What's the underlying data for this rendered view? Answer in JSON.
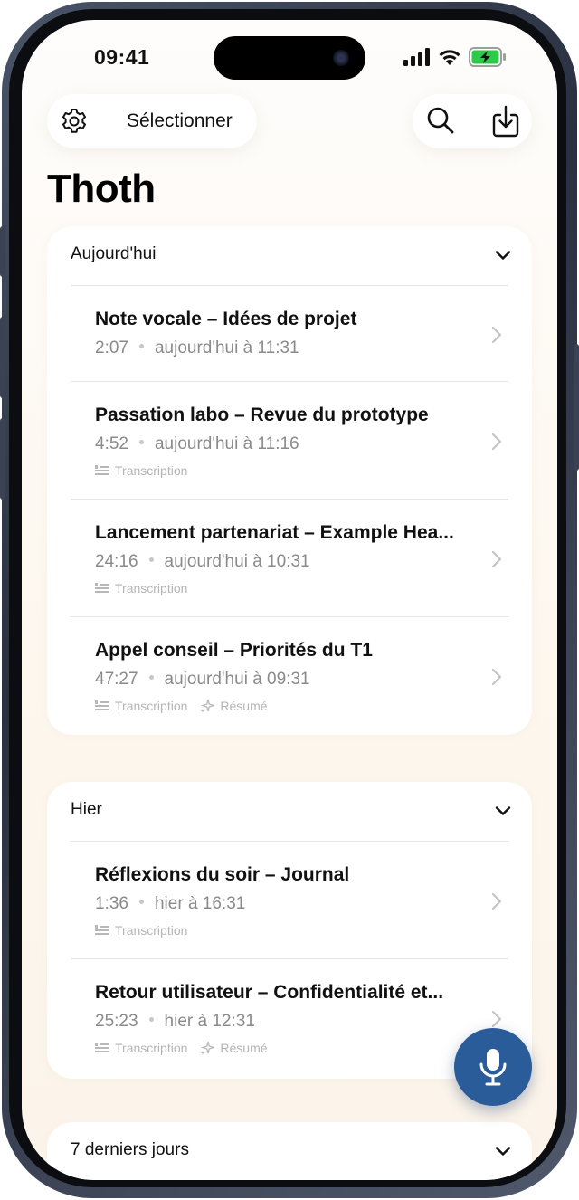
{
  "status_bar": {
    "time": "09:41"
  },
  "toolbar": {
    "select_label": "Sélectionner",
    "settings_icon": "gear-icon",
    "search_icon": "search-icon",
    "download_icon": "download-icon"
  },
  "page": {
    "title": "Thoth"
  },
  "sections": [
    {
      "label": "Aujourd'hui",
      "items": [
        {
          "title": "Note vocale – Idées de projet",
          "duration": "2:07",
          "when": "aujourd'hui à 11:31",
          "tags": []
        },
        {
          "title": "Passation labo – Revue du prototype",
          "duration": "4:52",
          "when": "aujourd'hui à 11:16",
          "tags": [
            "Transcription"
          ]
        },
        {
          "title": "Lancement partenariat – Example Hea...",
          "duration": "24:16",
          "when": "aujourd'hui à 10:31",
          "tags": [
            "Transcription"
          ]
        },
        {
          "title": "Appel conseil – Priorités du T1",
          "duration": "47:27",
          "when": "aujourd'hui à 09:31",
          "tags": [
            "Transcription",
            "Résumé"
          ]
        }
      ]
    },
    {
      "label": "Hier",
      "items": [
        {
          "title": "Réflexions du soir – Journal",
          "duration": "1:36",
          "when": "hier à 16:31",
          "tags": [
            "Transcription"
          ]
        },
        {
          "title": "Retour utilisateur – Confidentialité et...",
          "duration": "25:23",
          "when": "hier à 12:31",
          "tags": [
            "Transcription",
            "Résumé"
          ]
        }
      ]
    },
    {
      "label": "7 derniers jours",
      "items": []
    }
  ],
  "fab": {
    "icon": "microphone-icon",
    "color": "#2a5c9a"
  },
  "colors": {
    "accent": "#2a5c9a",
    "background": "#fdf7ef",
    "card": "#ffffff"
  }
}
